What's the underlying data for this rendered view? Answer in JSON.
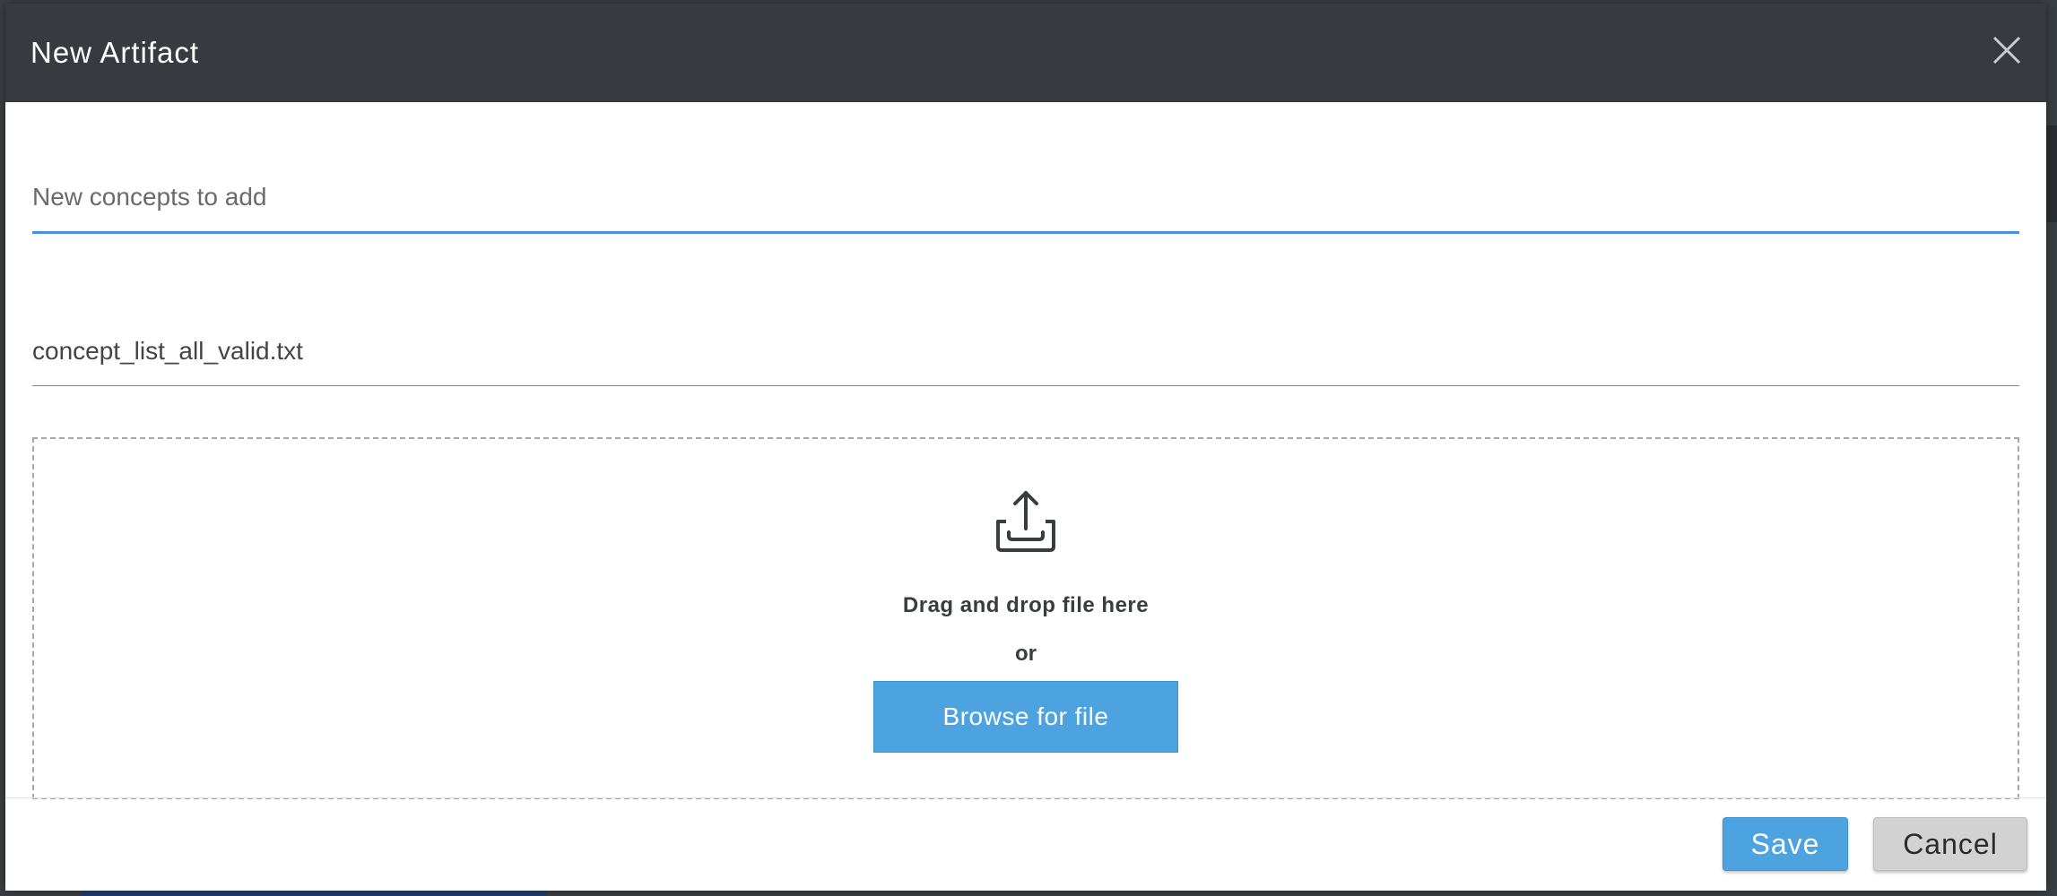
{
  "dialog": {
    "title": "New Artifact",
    "close_icon": "close-icon"
  },
  "form": {
    "concepts_field": {
      "placeholder": "New concepts to add",
      "value": ""
    },
    "file_field": {
      "value": "concept_list_all_valid.txt"
    }
  },
  "dropzone": {
    "icon": "upload-icon",
    "drag_text": "Drag and drop file here",
    "or_text": "or",
    "browse_label": "Browse for file"
  },
  "footer": {
    "save_label": "Save",
    "cancel_label": "Cancel"
  },
  "colors": {
    "header_bg": "#373b3f",
    "accent_blue": "#4da3e0",
    "focus_underline": "#4a90e2",
    "cancel_bg": "#d2d2d2"
  }
}
